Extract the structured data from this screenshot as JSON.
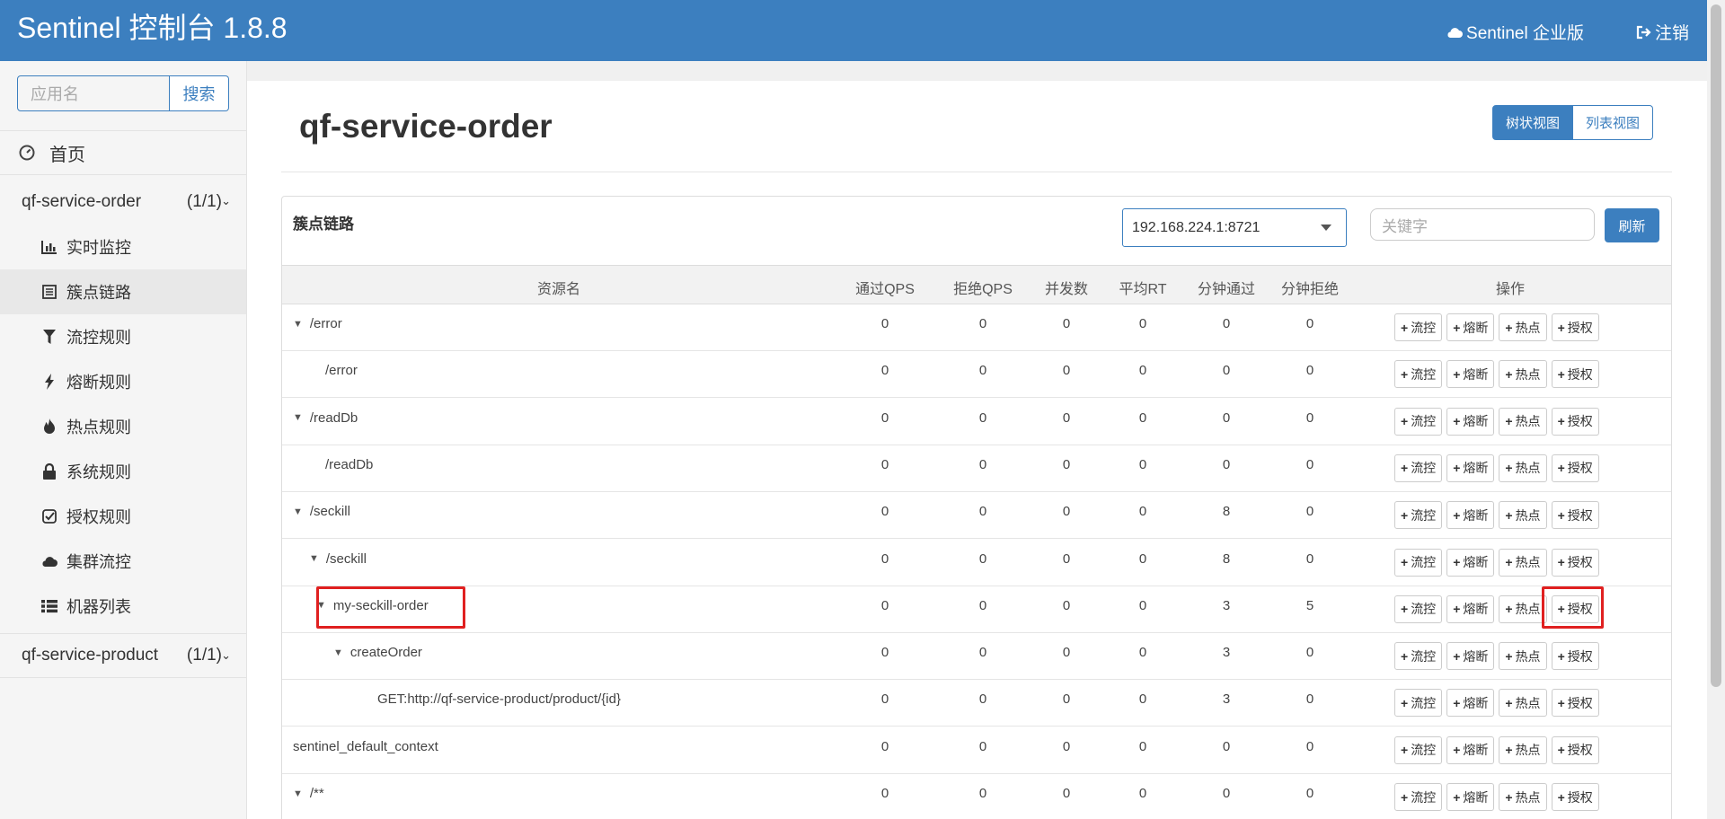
{
  "header": {
    "brand": "Sentinel 控制台 1.8.8",
    "enterprise": "Sentinel 企业版",
    "logout": "注销"
  },
  "sidebar": {
    "search_placeholder": "应用名",
    "search_button": "搜索",
    "home": "首页",
    "apps": [
      {
        "name": "qf-service-order",
        "count": "(1/1)"
      },
      {
        "name": "qf-service-product",
        "count": "(1/1)"
      }
    ],
    "menu": [
      {
        "label": "实时监控",
        "icon": "bar-chart-icon"
      },
      {
        "label": "簇点链路",
        "icon": "list-icon"
      },
      {
        "label": "流控规则",
        "icon": "filter-icon"
      },
      {
        "label": "熔断规则",
        "icon": "flash-icon"
      },
      {
        "label": "热点规则",
        "icon": "fire-icon"
      },
      {
        "label": "系统规则",
        "icon": "lock-icon"
      },
      {
        "label": "授权规则",
        "icon": "check-icon"
      },
      {
        "label": "集群流控",
        "icon": "cloud-icon"
      },
      {
        "label": "机器列表",
        "icon": "th-list-icon"
      }
    ]
  },
  "main": {
    "title": "qf-service-order",
    "view_tree": "树状视图",
    "view_list": "列表视图",
    "panel_title": "簇点链路",
    "machine": "192.168.224.1:8721",
    "keyword_placeholder": "关键字",
    "refresh": "刷新",
    "columns": [
      "资源名",
      "通过QPS",
      "拒绝QPS",
      "并发数",
      "平均RT",
      "分钟通过",
      "分钟拒绝",
      "操作"
    ],
    "ops": [
      "流控",
      "熔断",
      "热点",
      "授权"
    ],
    "rows": [
      {
        "name": "/error",
        "level": 0,
        "expand": true,
        "values": [
          "0",
          "0",
          "0",
          "0",
          "0",
          "0"
        ]
      },
      {
        "name": "/error",
        "level": 1,
        "expand": false,
        "values": [
          "0",
          "0",
          "0",
          "0",
          "0",
          "0"
        ]
      },
      {
        "name": "/readDb",
        "level": 0,
        "expand": true,
        "values": [
          "0",
          "0",
          "0",
          "0",
          "0",
          "0"
        ]
      },
      {
        "name": "/readDb",
        "level": 1,
        "expand": false,
        "values": [
          "0",
          "0",
          "0",
          "0",
          "0",
          "0"
        ]
      },
      {
        "name": "/seckill",
        "level": 0,
        "expand": true,
        "values": [
          "0",
          "0",
          "0",
          "0",
          "8",
          "0"
        ]
      },
      {
        "name": "/seckill",
        "level": 1,
        "expand": true,
        "values": [
          "0",
          "0",
          "0",
          "0",
          "8",
          "0"
        ]
      },
      {
        "name": "my-seckill-order",
        "level": 2,
        "expand": true,
        "values": [
          "0",
          "0",
          "0",
          "0",
          "3",
          "5"
        ]
      },
      {
        "name": "createOrder",
        "level": 3,
        "expand": true,
        "values": [
          "0",
          "0",
          "0",
          "0",
          "3",
          "0"
        ]
      },
      {
        "name": "GET:http://qf-service-product/product/{id}",
        "level": 4,
        "expand": false,
        "values": [
          "0",
          "0",
          "0",
          "0",
          "3",
          "0"
        ]
      },
      {
        "name": "sentinel_default_context",
        "level": 0,
        "expand": false,
        "values": [
          "0",
          "0",
          "0",
          "0",
          "0",
          "0"
        ]
      },
      {
        "name": "/**",
        "level": 0,
        "expand": true,
        "values": [
          "0",
          "0",
          "0",
          "0",
          "0",
          "0"
        ]
      }
    ]
  },
  "colors": {
    "header": "#3c7fbf",
    "highlight": "#e02020"
  }
}
